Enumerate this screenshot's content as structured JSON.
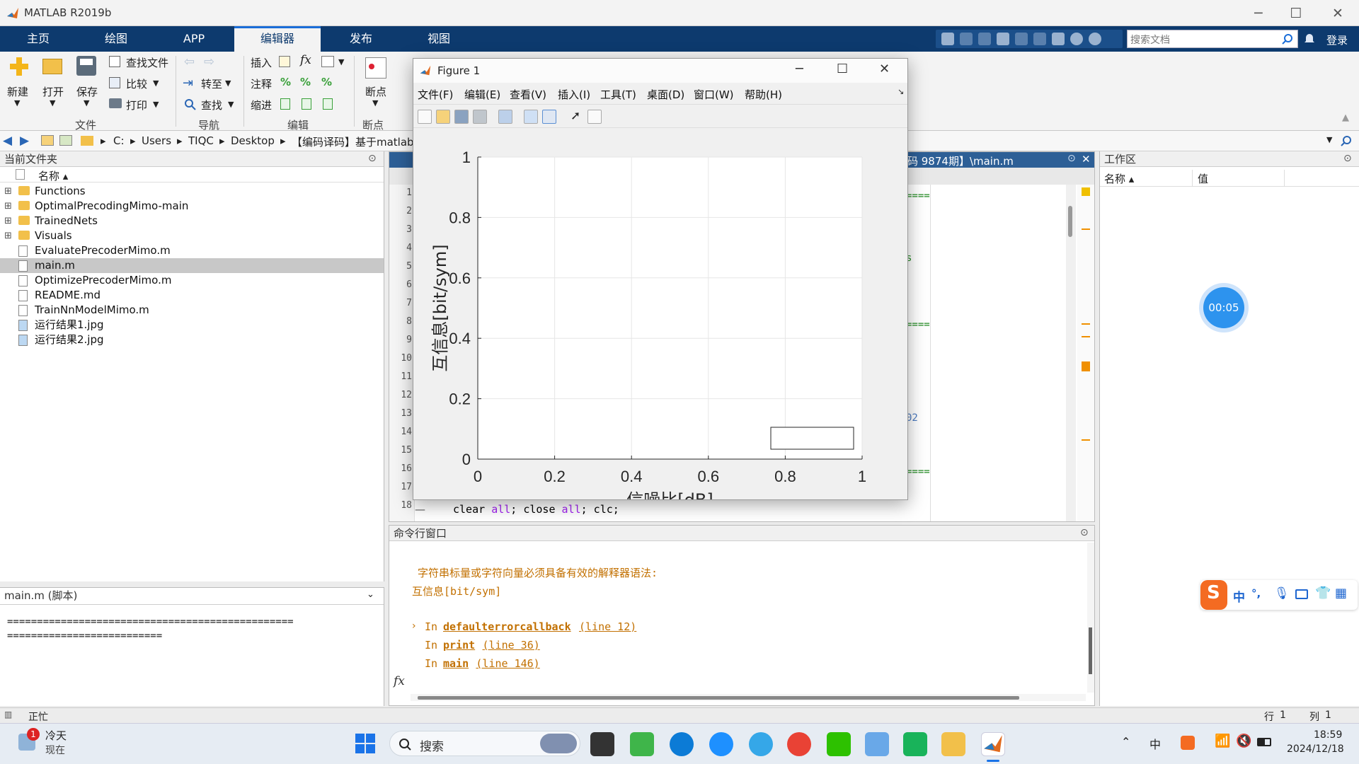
{
  "app": {
    "title": "MATLAB R2019b"
  },
  "window_controls": {
    "minimize": "─",
    "maximize": "☐",
    "close": "✕"
  },
  "tabs": [
    {
      "label": "主页"
    },
    {
      "label": "绘图"
    },
    {
      "label": "APP"
    },
    {
      "label": "编辑器"
    },
    {
      "label": "发布"
    },
    {
      "label": "视图"
    }
  ],
  "search": {
    "placeholder": "搜索文档",
    "login": "登录"
  },
  "ribbon": {
    "new": "新建",
    "open": "打开",
    "save": "保存",
    "find_files": "查找文件",
    "compare": "比较",
    "print": "打印",
    "file_section": "文件",
    "goto": "转至",
    "find": "查找",
    "nav_section": "导航",
    "insert": "插入",
    "comment": "注释",
    "indent": "缩进",
    "fx": "fx",
    "edit_section": "编辑",
    "breakpoint": "断点",
    "bp_section": "断点"
  },
  "breadcrumb": [
    "C:",
    "Users",
    "TIQC",
    "Desktop",
    "【编码译码】基于matlab"
  ],
  "file_panel": {
    "title": "当前文件夹",
    "col_name": "名称 ▴",
    "items": [
      {
        "name": "Functions",
        "type": "folder"
      },
      {
        "name": "OptimalPrecodingMimo-main",
        "type": "folder"
      },
      {
        "name": "TrainedNets",
        "type": "folder"
      },
      {
        "name": "Visuals",
        "type": "folder"
      },
      {
        "name": "EvaluatePrecoderMimo.m",
        "type": "file"
      },
      {
        "name": "main.m",
        "type": "file",
        "selected": true
      },
      {
        "name": "OptimizePrecoderMimo.m",
        "type": "file"
      },
      {
        "name": "README.md",
        "type": "file"
      },
      {
        "name": "TrainNnModelMimo.m",
        "type": "file"
      },
      {
        "name": "运行结果1.jpg",
        "type": "image"
      },
      {
        "name": "运行结果2.jpg",
        "type": "image"
      }
    ]
  },
  "detail_panel": {
    "title": "main.m (脚本)",
    "line1": "================================================",
    "line2": "=========================="
  },
  "editor": {
    "title_tail": "码 9874期】\\main.m",
    "line_numbers": [
      "1",
      "2",
      "3",
      "4",
      "5",
      "6",
      "7",
      "8",
      "9",
      "10",
      "11",
      "12",
      "13",
      "14",
      "15",
      "16",
      "17",
      "18"
    ],
    "visible_code": {
      "line18": "clear all; close all; clc;"
    },
    "right_fragments": [
      "====",
      "s",
      "====",
      "02",
      "===="
    ]
  },
  "command_window": {
    "title": "命令行窗口",
    "error_line1": "字符串标量或字符向量必须具备有效的解释器语法:",
    "error_line2": "互信息[bit/sym]",
    "stack": [
      {
        "prefix": "In",
        "fn": "defaulterrorcallback",
        "loc": "(line 12)"
      },
      {
        "prefix": "In",
        "fn": "print",
        "loc": "(line 36)"
      },
      {
        "prefix": "In",
        "fn": "main",
        "loc": "(line 146)"
      }
    ],
    "fx": "fx"
  },
  "workspace": {
    "title": "工作区",
    "col_name": "名称 ▴",
    "col_value": "值"
  },
  "timer": {
    "label": "00:05"
  },
  "figure": {
    "title": "Figure 1",
    "menus": [
      "文件(F)",
      "编辑(E)",
      "查看(V)",
      "插入(I)",
      "工具(T)",
      "桌面(D)",
      "窗口(W)",
      "帮助(H)"
    ]
  },
  "chart_data": {
    "type": "line",
    "title": "",
    "xlabel": "信噪比[dB]",
    "ylabel": "互信息[bit/sym]",
    "xlim": [
      0,
      1
    ],
    "ylim": [
      0,
      1
    ],
    "xticks": [
      0,
      0.2,
      0.4,
      0.6,
      0.8,
      1
    ],
    "yticks": [
      0,
      0.2,
      0.4,
      0.6,
      0.8,
      1
    ],
    "xtick_labels": [
      "0",
      "0.2",
      "0.4",
      "0.6",
      "0.8",
      "1"
    ],
    "ytick_labels": [
      "0",
      "0.2",
      "0.4",
      "0.6",
      "0.8",
      "1"
    ],
    "grid": true,
    "legend": {
      "position": "bottom-right",
      "entries": []
    },
    "series": []
  },
  "statusbar": {
    "text": "正忙",
    "row_label": "行",
    "row": "1",
    "col_label": "列",
    "col": "1"
  },
  "ime": {
    "lang": "中",
    "punct": "°,"
  },
  "taskbar": {
    "weather_badge": "1",
    "weather_title": "冷天",
    "weather_sub": "现在",
    "search": "搜索",
    "time": "18:59",
    "date": "2024/12/18"
  },
  "colors": {
    "ribbon_tab_bg": "#0d3a6e",
    "accent": "#1a6dd8",
    "error_text": "#c27000",
    "selection": "#c8c8c8"
  }
}
